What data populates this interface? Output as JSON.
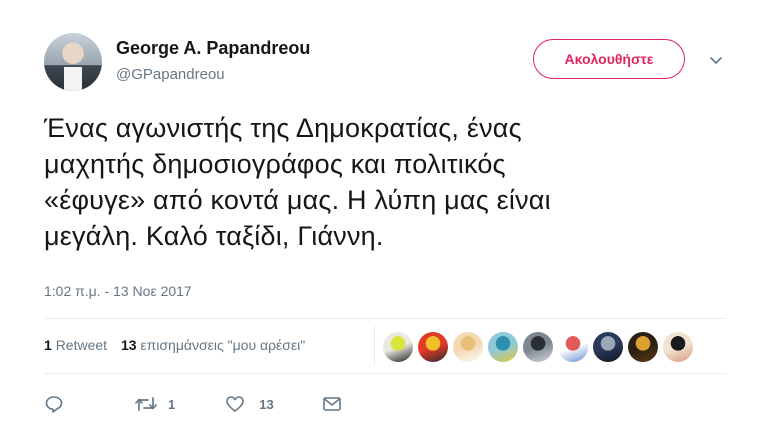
{
  "author": {
    "name": "George A. Papandreou",
    "handle": "@GPapandreou"
  },
  "follow_label": "Ακολουθήστε",
  "tweet_lines": [
    "Ένας αγωνιστής της Δημοκρατίας, ένας",
    "μαχητής δημοσιογράφος και πολιτικός",
    "«έφυγε» από κοντά μας. Η λύπη μας είναι",
    "μεγάλη. Καλό ταξίδι, Γιάννη."
  ],
  "timestamp": "1:02 π.μ. - 13 Νοε 2017",
  "stats": {
    "retweets_count": "1",
    "retweets_label": "Retweet",
    "likes_count": "13",
    "likes_label": "επισημάνσεις \"μου αρέσει\""
  },
  "actions": {
    "retweet_count": "1",
    "like_count": "13"
  },
  "liker_avatars": [
    {
      "name": "liker-avatar-1",
      "colors": [
        "#e9e9e0",
        "#d8e63a",
        "#1d1d1d"
      ]
    },
    {
      "name": "liker-avatar-2",
      "colors": [
        "#e23b2a",
        "#f0c02a",
        "#2a2a2a"
      ]
    },
    {
      "name": "liker-avatar-3",
      "colors": [
        "#f4d9b0",
        "#e8c07a",
        "#fafafa"
      ]
    },
    {
      "name": "liker-avatar-4",
      "colors": [
        "#8ec9d8",
        "#2d8fb0",
        "#e0c83a"
      ]
    },
    {
      "name": "liker-avatar-5",
      "colors": [
        "#7b8794",
        "#2b2f35",
        "#d6d6d6"
      ]
    },
    {
      "name": "liker-avatar-6",
      "colors": [
        "#ffffff",
        "#e35a5a",
        "#6a8fd0"
      ]
    },
    {
      "name": "liker-avatar-7",
      "colors": [
        "#2b3a5a",
        "#9aa8b8",
        "#0d1320"
      ]
    },
    {
      "name": "liker-avatar-8",
      "colors": [
        "#2b2012",
        "#e0a030",
        "#5a3a18"
      ]
    },
    {
      "name": "liker-avatar-9",
      "colors": [
        "#f2e2d2",
        "#1b1b1b",
        "#d89a7a"
      ]
    }
  ]
}
